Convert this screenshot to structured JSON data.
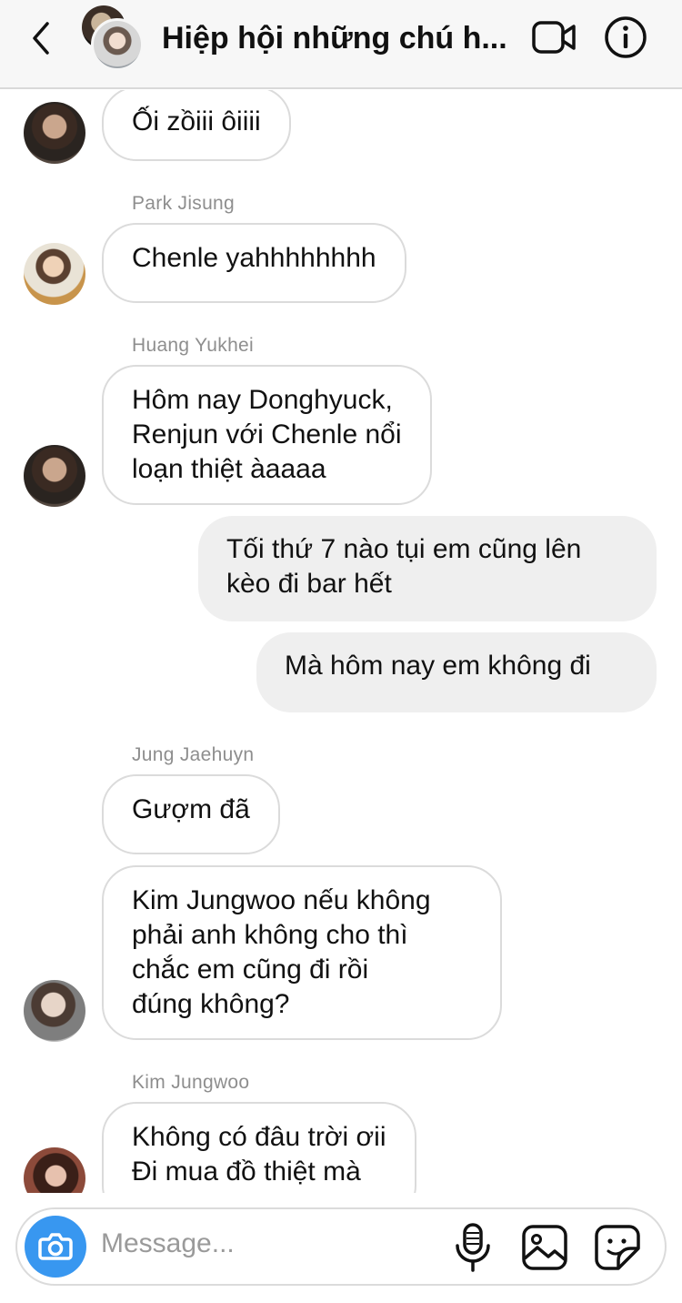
{
  "header": {
    "title": "Hiệp hội những chú h...",
    "back_icon": "chevron-left-icon",
    "video_icon": "video-camera-icon",
    "info_icon": "info-icon"
  },
  "messages": [
    {
      "type": "incoming",
      "sender": "",
      "lines": [
        "Ối zồiii ôiiii"
      ],
      "avatar": true
    },
    {
      "type": "incoming",
      "sender": "Park Jisung",
      "lines": [
        "Chenle yahhhhhhhh"
      ],
      "avatar": true
    },
    {
      "type": "incoming",
      "sender": "Huang Yukhei",
      "lines": [
        "Hôm nay Donghyuck,",
        "Renjun với Chenle nổi",
        "loạn thiệt àaaaa"
      ],
      "avatar": true
    },
    {
      "type": "outgoing",
      "lines": [
        "Tối thứ 7 nào tụi em cũng lên",
        "kèo đi bar hết"
      ]
    },
    {
      "type": "outgoing",
      "lines": [
        "Mà hôm nay em không đi"
      ]
    },
    {
      "type": "incoming",
      "sender": "Jung Jaehuyn",
      "lines": [
        "Gượm đã"
      ],
      "avatar": false
    },
    {
      "type": "incoming",
      "sender": "",
      "lines": [
        "Kim Jungwoo nếu không",
        "phải anh không cho thì",
        "chắc em cũng đi rồi",
        "đúng không?"
      ],
      "avatar": true
    },
    {
      "type": "incoming",
      "sender": "Kim Jungwoo",
      "lines": [
        "Không có đâu trời ơii",
        "Đi mua đồ thiệt mà"
      ],
      "avatar": true
    }
  ],
  "composer": {
    "placeholder": "Message...",
    "camera_icon": "camera-icon",
    "mic_icon": "microphone-icon",
    "gallery_icon": "image-gallery-icon",
    "sticker_icon": "sticker-icon"
  },
  "colors": {
    "accent": "#3897f0",
    "outgoing_bubble": "#efefef",
    "incoming_border": "#dbdbdb",
    "sender_text": "#8e8e8e"
  }
}
